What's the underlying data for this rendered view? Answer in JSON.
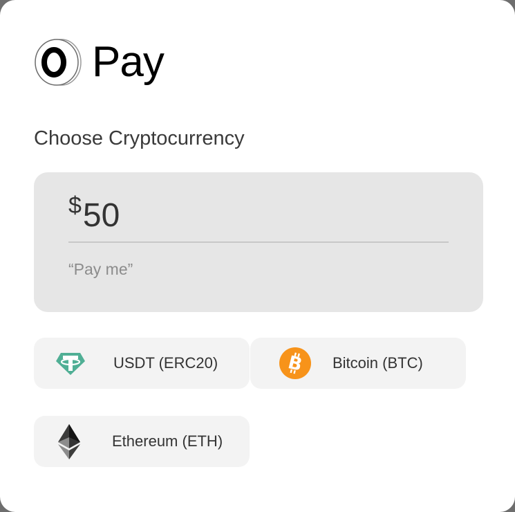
{
  "brand": {
    "logo_text": "Pay",
    "logo_icon": "o-ring-logo-icon"
  },
  "section": {
    "title": "Choose Cryptocurrency"
  },
  "amount": {
    "currency_symbol": "$",
    "value": "50",
    "note": "“Pay me”"
  },
  "cryptocurrencies": [
    {
      "label": "USDT (ERC20)",
      "icon": "tether-icon",
      "color": "#50af95"
    },
    {
      "label": "Bitcoin (BTC)",
      "icon": "bitcoin-icon",
      "color": "#f7931a"
    },
    {
      "label": "Ethereum (ETH)",
      "icon": "ethereum-icon",
      "color": "#343434"
    }
  ],
  "colors": {
    "card_background": "#ffffff",
    "amount_panel": "#e6e6e6",
    "option_background": "#f3f3f3",
    "text": "#333333",
    "muted_text": "#8c8c8c"
  }
}
